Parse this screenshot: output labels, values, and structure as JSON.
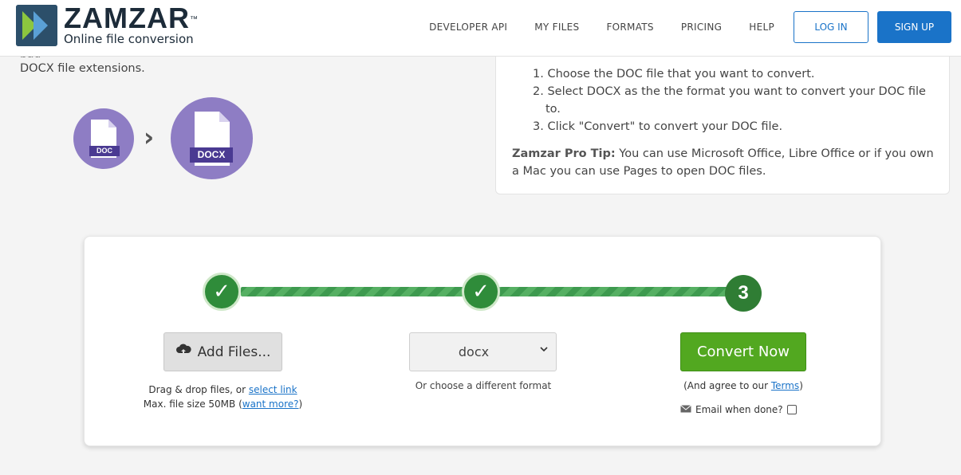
{
  "header": {
    "logo_title": "ZAMZAR",
    "logo_tm": "™",
    "logo_subtitle": "Online file conversion",
    "nav": [
      "DEVELOPER API",
      "MY FILES",
      "FORMATS",
      "PRICING",
      "HELP"
    ],
    "login_label": "LOG IN",
    "signup_label": "SIGN UP"
  },
  "intro": {
    "clipped_text": "pag",
    "extensions_text": "DOCX file extensions."
  },
  "conversion_icons": {
    "from_label": "DOC",
    "to_label": "DOCX",
    "separator": "›"
  },
  "info_card": {
    "steps": [
      "1. Choose the DOC file that you want to convert.",
      "2. Select DOCX as the the format you want to convert your DOC file",
      "to.",
      "3. Click \"Convert\" to convert your DOC file."
    ],
    "tip_title": "Zamzar Pro Tip:",
    "tip_text": " You can use Microsoft Office, Libre Office or if you own a Mac you can use Pages to open DOC files."
  },
  "converter": {
    "step1_check": "✓",
    "step2_check": "✓",
    "step3_number": "3",
    "add_files_label": "Add Files...",
    "drag_text": "Drag & drop files, or ",
    "select_link": "select link",
    "max_size_text": "Max. file size 50MB (",
    "want_more_link": "want more?",
    "max_size_close": ")",
    "format_value": "docx",
    "format_hint": "Or choose a different format",
    "convert_label": "Convert Now",
    "agree_text": "(And agree to our ",
    "terms_link": "Terms",
    "agree_close": ")",
    "email_label": "Email when done?"
  },
  "colors": {
    "brand_blue": "#1a73c8",
    "convert_green": "#52a820",
    "step_green": "#2f8c3a",
    "file_purple": "#8e7dc4"
  }
}
